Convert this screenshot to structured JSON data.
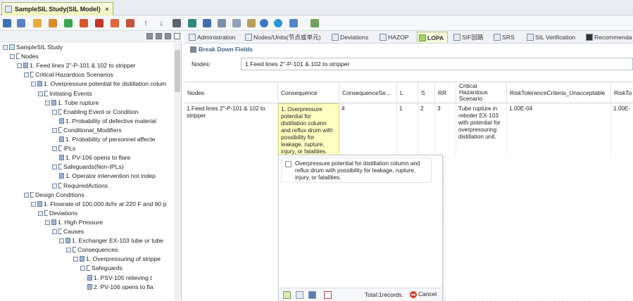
{
  "document_tab": {
    "title": "SampleSIL Study(SIL Model)",
    "close_glyph": "×"
  },
  "toolbar": {
    "icons": [
      "save-icon",
      "save-as-icon",
      "open-folder-icon",
      "edit-icon",
      "add-icon",
      "delete-icon",
      "cut-icon",
      "copy-icon",
      "paste-icon",
      "up-arrow-icon",
      "down-arrow-icon",
      "import-icon",
      "export-icon",
      "grid-icon",
      "table-icon",
      "tree-icon",
      "filter-icon",
      "refresh-icon",
      "globe-icon",
      "settings-icon",
      "report-icon"
    ],
    "up_glyph": "↑",
    "down_glyph": "↓"
  },
  "tree": [
    {
      "label": "SampleSIL Study",
      "depth": 0,
      "kind": "root"
    },
    {
      "label": "Nodes",
      "depth": 1,
      "kind": "list"
    },
    {
      "label": "1. Feed lines 2\"-P-101 & 102 to stripper",
      "depth": 2,
      "kind": "item"
    },
    {
      "label": "Critical Hazardous Scenarios",
      "depth": 3,
      "kind": "list"
    },
    {
      "label": "1. Overpressure potential for distillation colum",
      "depth": 4,
      "kind": "item"
    },
    {
      "label": "Initiating Events",
      "depth": 5,
      "kind": "list"
    },
    {
      "label": "1. Tube rupture",
      "depth": 6,
      "kind": "item"
    },
    {
      "label": "Enabling Event or Condition",
      "depth": 7,
      "kind": "list"
    },
    {
      "label": "1. Probability of defective material",
      "depth": 8,
      "kind": "leaf"
    },
    {
      "label": "Conditional_Modifiers",
      "depth": 7,
      "kind": "list"
    },
    {
      "label": "1. Probability of personnel affecte",
      "depth": 8,
      "kind": "leaf"
    },
    {
      "label": "IPLs",
      "depth": 7,
      "kind": "list"
    },
    {
      "label": "1. PV-106 opens to flare",
      "depth": 8,
      "kind": "leaf"
    },
    {
      "label": "Safeguards(Non-IPLs)",
      "depth": 7,
      "kind": "list"
    },
    {
      "label": "1. Operator intervention not indep",
      "depth": 8,
      "kind": "leaf"
    },
    {
      "label": "RequiredActions",
      "depth": 7,
      "kind": "list"
    },
    {
      "label": "Design Conditions",
      "depth": 3,
      "kind": "list"
    },
    {
      "label": "1. Flowrate of 100,000 lb/hr at 220 F and 90 p",
      "depth": 4,
      "kind": "item"
    },
    {
      "label": "Deviations",
      "depth": 5,
      "kind": "list"
    },
    {
      "label": "1. High Pressure",
      "depth": 6,
      "kind": "item"
    },
    {
      "label": "Causes",
      "depth": 7,
      "kind": "list"
    },
    {
      "label": "1. Exchanger EX-103 tube or tube",
      "depth": 8,
      "kind": "item"
    },
    {
      "label": "Consequences",
      "depth": 9,
      "kind": "list"
    },
    {
      "label": "1. Overpressuring of strippe",
      "depth": 10,
      "kind": "item"
    },
    {
      "label": "Safeguards",
      "depth": 11,
      "kind": "list"
    },
    {
      "label": "1. PSV-105 relieving t",
      "depth": 12,
      "kind": "leaf"
    },
    {
      "label": "2. PV-106 opens to fla",
      "depth": 12,
      "kind": "leaf"
    }
  ],
  "module_tabs": [
    "Administration",
    "Nodes/Units(节点或单元)",
    "Deviations",
    "HAZOP",
    "LOPA",
    "SIF回路",
    "SRS",
    "SIL Verification",
    "Recommenda"
  ],
  "active_module_tab": "LOPA",
  "breakdown": {
    "title": "Break Down Fields",
    "nodes_label": "Nodes:",
    "nodes_value": "1.Feed lines 2\"-P-101 & 102  to stripper"
  },
  "grid": {
    "columns": [
      "Nodes",
      "Consequence",
      "ConsequenceSe...",
      "L",
      "S",
      "RR",
      "Critical Hazardous Scenario",
      "RiskToleranceCriteria_Unacceptable",
      "RiskTo"
    ],
    "row": [
      "1.Feed lines 2\"-P-101 & 102 to stripper",
      "1. Overpressure potential for distillation column and reflux drum with possibility for leakage, rupture, injury, or fatalities.",
      "4",
      "1",
      "2",
      "3",
      "Tube rupture in reboiler EX-103 with potential for overpressuring distillation unit.",
      "1.00E-04",
      "1.00E-"
    ]
  },
  "popup": {
    "option": "Overpressure potential for distillation column and reflux drum with possibility for leakage, rupture, injury, or fatalities.",
    "total": "Total:1records.",
    "cancel": "Cancel"
  }
}
